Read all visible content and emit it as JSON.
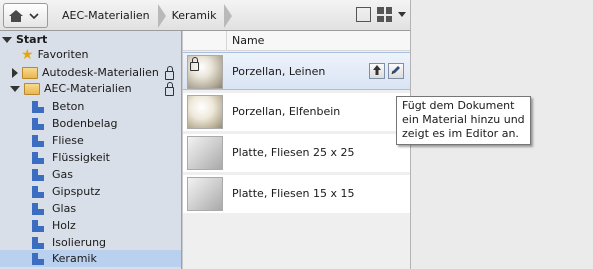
{
  "breadcrumb": {
    "items": [
      "AEC-Materialien",
      "Keramik"
    ]
  },
  "tree": {
    "root_label": "Start",
    "favorites_label": "Favoriten",
    "autodesk_label": "Autodesk-Materialien",
    "aec_label": "AEC-Materialien",
    "categories": [
      "Beton",
      "Bodenbelag",
      "Fliese",
      "Flüssigkeit",
      "Gas",
      "Gipsputz",
      "Glas",
      "Holz",
      "Isolierung",
      "Keramik"
    ]
  },
  "list": {
    "column_header": "Name",
    "rows": [
      {
        "name": "Porzellan, Leinen"
      },
      {
        "name": "Porzellan, Elfenbein"
      },
      {
        "name": "Platte, Fliesen 25 x 25"
      },
      {
        "name": "Platte, Fliesen 15 x 15"
      }
    ]
  },
  "tooltip": {
    "lines": [
      "Fügt dem Dokument",
      "ein Material hinzu und",
      "zeigt es im Editor an."
    ]
  }
}
